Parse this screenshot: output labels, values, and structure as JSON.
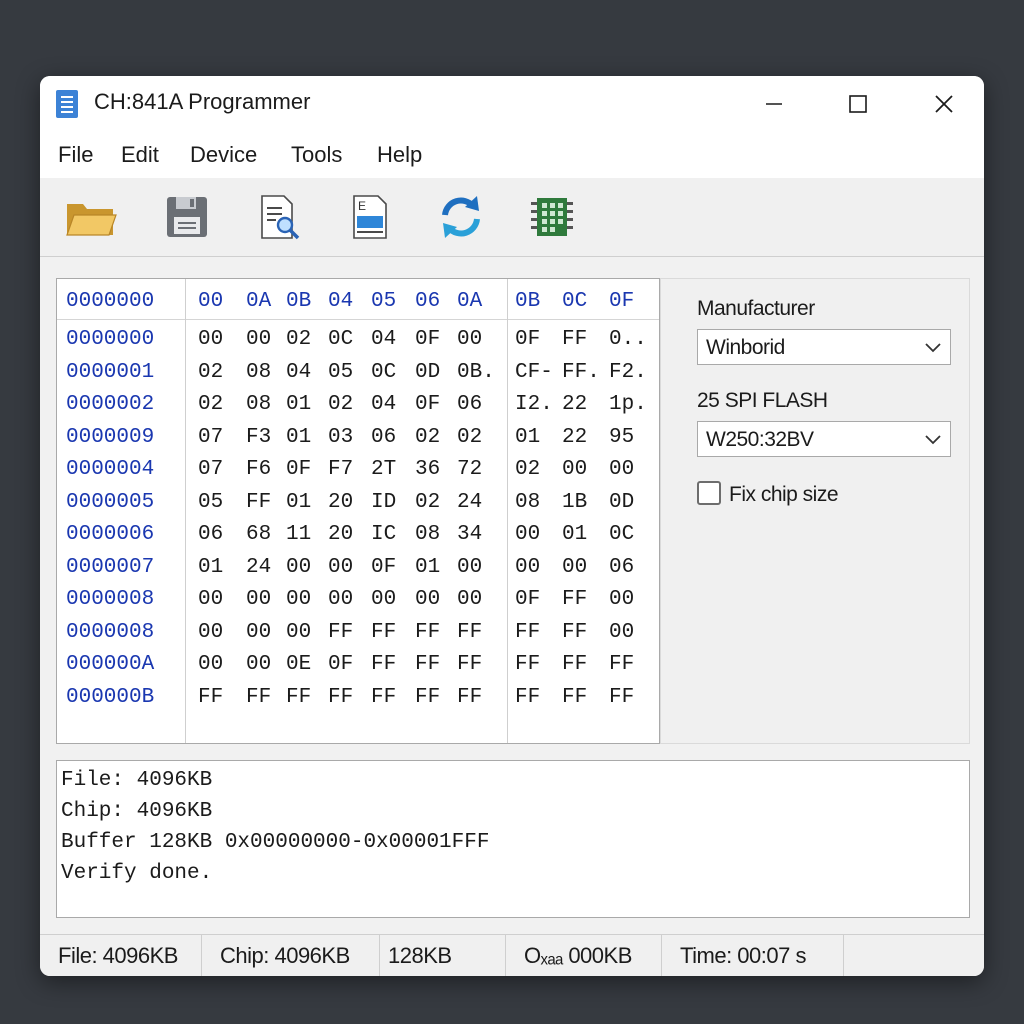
{
  "window": {
    "title": "CH:841A Programmer"
  },
  "menu": [
    "File",
    "Edit",
    "Device",
    "Tools",
    "Help"
  ],
  "toolbar": [
    {
      "name": "open-folder-icon",
      "color": "#e8b84a"
    },
    {
      "name": "save-icon",
      "color": "#6b6f75"
    },
    {
      "name": "read-document-icon",
      "color": "#3c82d6"
    },
    {
      "name": "write-icon",
      "color": "#2e86d8"
    },
    {
      "name": "sync-icon",
      "color": "#1f6fc0"
    },
    {
      "name": "chip-icon",
      "color": "#2f7a3c"
    }
  ],
  "hex": {
    "header_addr": "0000000",
    "header_cols": [
      "00",
      "0A",
      "0B",
      "04",
      "05",
      "06",
      "0A",
      "0B",
      "0C",
      "0F"
    ],
    "rows": [
      {
        "addr": "0000000",
        "cells": [
          "00",
          "00",
          "02",
          "0C",
          "04",
          "0F",
          "00",
          "0F",
          "FF",
          "0.."
        ]
      },
      {
        "addr": "0000001",
        "cells": [
          "02",
          "08",
          "04",
          "05",
          "0C",
          "0D",
          "0B.",
          "CF-",
          "FF.",
          "F2."
        ]
      },
      {
        "addr": "0000002",
        "cells": [
          "02",
          "08",
          "01",
          "02",
          "04",
          "0F",
          "06",
          "I2.",
          "22",
          "1p."
        ]
      },
      {
        "addr": "0000009",
        "cells": [
          "07",
          "F3",
          "01",
          "03",
          "06",
          "02",
          "02",
          "01",
          "22",
          "95"
        ]
      },
      {
        "addr": "0000004",
        "cells": [
          "07",
          "F6",
          "0F",
          "F7",
          "2T",
          "36",
          "72",
          "02",
          "00",
          "00"
        ]
      },
      {
        "addr": "0000005",
        "cells": [
          "05",
          "FF",
          "01",
          "20",
          "ID",
          "02",
          "24",
          "08",
          "1B",
          "0D"
        ]
      },
      {
        "addr": "0000006",
        "cells": [
          "06",
          "68",
          "11",
          "20",
          "IC",
          "08",
          "34",
          "00",
          "01",
          "0C"
        ]
      },
      {
        "addr": "0000007",
        "cells": [
          "01",
          "24",
          "00",
          "00",
          "0F",
          "01",
          "00",
          "00",
          "00",
          "06"
        ]
      },
      {
        "addr": "0000008",
        "cells": [
          "00",
          "00",
          "00",
          "00",
          "00",
          "00",
          "00",
          "0F",
          "FF",
          "00"
        ]
      },
      {
        "addr": "0000008",
        "cells": [
          "00",
          "00",
          "00",
          "FF",
          "FF",
          "FF",
          "FF",
          "FF",
          "FF",
          "00"
        ]
      },
      {
        "addr": "000000A",
        "cells": [
          "00",
          "00",
          "0E",
          "0F",
          "FF",
          "FF",
          "FF",
          "FF",
          "FF",
          "FF"
        ]
      },
      {
        "addr": "000000B",
        "cells": [
          "FF",
          "FF",
          "FF",
          "FF",
          "FF",
          "FF",
          "FF",
          "FF",
          "FF",
          "FF"
        ]
      }
    ]
  },
  "side": {
    "manufacturer_label": "Manufacturer",
    "manufacturer_value": "Winborid",
    "chip_label": "25 SPI FLASH",
    "chip_value": "W250:32BV",
    "fix_chip_size_label": "Fix chip size",
    "fix_chip_size_checked": false
  },
  "log": [
    "File: 4096KB",
    "Chip: 4096KB",
    "Buffer 128KB 0x00000000-0x00001FFF",
    "Verify done."
  ],
  "status": {
    "file": "File: 4096KB",
    "chip": "Chip: 4096KB",
    "buffer": "128KB",
    "offset": "Oₓₐₐ 000KB",
    "time": "Time: 00:07  s"
  }
}
